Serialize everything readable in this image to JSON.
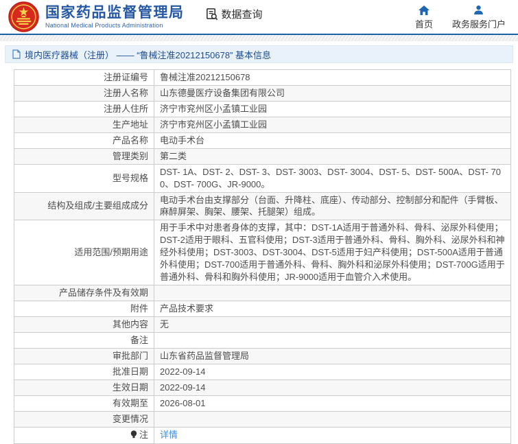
{
  "header": {
    "agency_name_cn": "国家药品监督管理局",
    "agency_name_en": "National Medical Products Administration",
    "data_query_label": "数据查询",
    "nav": [
      {
        "label": "首页",
        "icon": "home-icon"
      },
      {
        "label": "政务服务门户",
        "icon": "user-icon"
      }
    ]
  },
  "breadcrumb": {
    "text": "境内医疗器械（注册） —— “鲁械注准20212150678” 基本信息"
  },
  "table": {
    "rows": [
      {
        "label": "注册证编号",
        "value": "鲁械注准20212150678"
      },
      {
        "label": "注册人名称",
        "value": "山东德曼医疗设备集团有限公司"
      },
      {
        "label": "注册人住所",
        "value": "济宁市兖州区小孟镇工业园"
      },
      {
        "label": "生产地址",
        "value": "济宁市兖州区小孟镇工业园"
      },
      {
        "label": "产品名称",
        "value": "电动手术台"
      },
      {
        "label": "管理类别",
        "value": "第二类"
      },
      {
        "label": "型号规格",
        "value": "DST- 1A、DST- 2、DST- 3、DST- 3003、DST- 3004、DST- 5、DST- 500A、DST- 700、DST- 700G、JR-9000。"
      },
      {
        "label": "结构及组成/主要组成成分",
        "value": "电动手术台由支撑部分（台面、升降柱、底座）、传动部分、控制部分和配件（手臂板、麻醉屏架、胸架、腰架、托腿架）组成。"
      },
      {
        "label": "适用范围/预期用途",
        "value": "用于手术中对患者身体的支撑，其中：DST-1A适用于普通外科、骨科、泌尿外科使用；DST-2适用于眼科、五官科使用；DST-3适用于普通外科、骨科、胸外科、泌尿外科和神经外科使用；DST-3003、DST-3004、DST-5适用于妇产科使用；DST-500A适用于普通外科使用；DST-700适用于普通外科、骨科、胸外科和泌尿外科使用；DST-700G适用于普通外科、骨科和胸外科使用；JR-9000适用于血管介入术使用。"
      },
      {
        "label": "产品储存条件及有效期",
        "value": ""
      },
      {
        "label": "附件",
        "value": "产品技术要求"
      },
      {
        "label": "其他内容",
        "value": "无"
      },
      {
        "label": "备注",
        "value": ""
      },
      {
        "label": "审批部门",
        "value": "山东省药品监督管理局"
      },
      {
        "label": "批准日期",
        "value": "2022-09-14"
      },
      {
        "label": "生效日期",
        "value": "2022-09-14"
      },
      {
        "label": "有效期至",
        "value": "2026-08-01"
      },
      {
        "label": "变更情况",
        "value": ""
      },
      {
        "label": "注",
        "value": "详情",
        "icon": "bulb-icon",
        "link": true
      }
    ]
  },
  "colors": {
    "brand_blue": "#2457a4",
    "header_rule_blue": "#1f5fa8",
    "breadcrumb_bg": "#e9f2fa",
    "breadcrumb_text": "#1d4c92",
    "table_border": "#cccccc",
    "row_alt_bg": "#f7f7f7",
    "body_text": "#4d4d4d",
    "link_blue": "#3a8ee6",
    "emblem_red": "#d7281e",
    "emblem_gold": "#f7d64a",
    "nav_icon_blue": "#1f66b5"
  }
}
